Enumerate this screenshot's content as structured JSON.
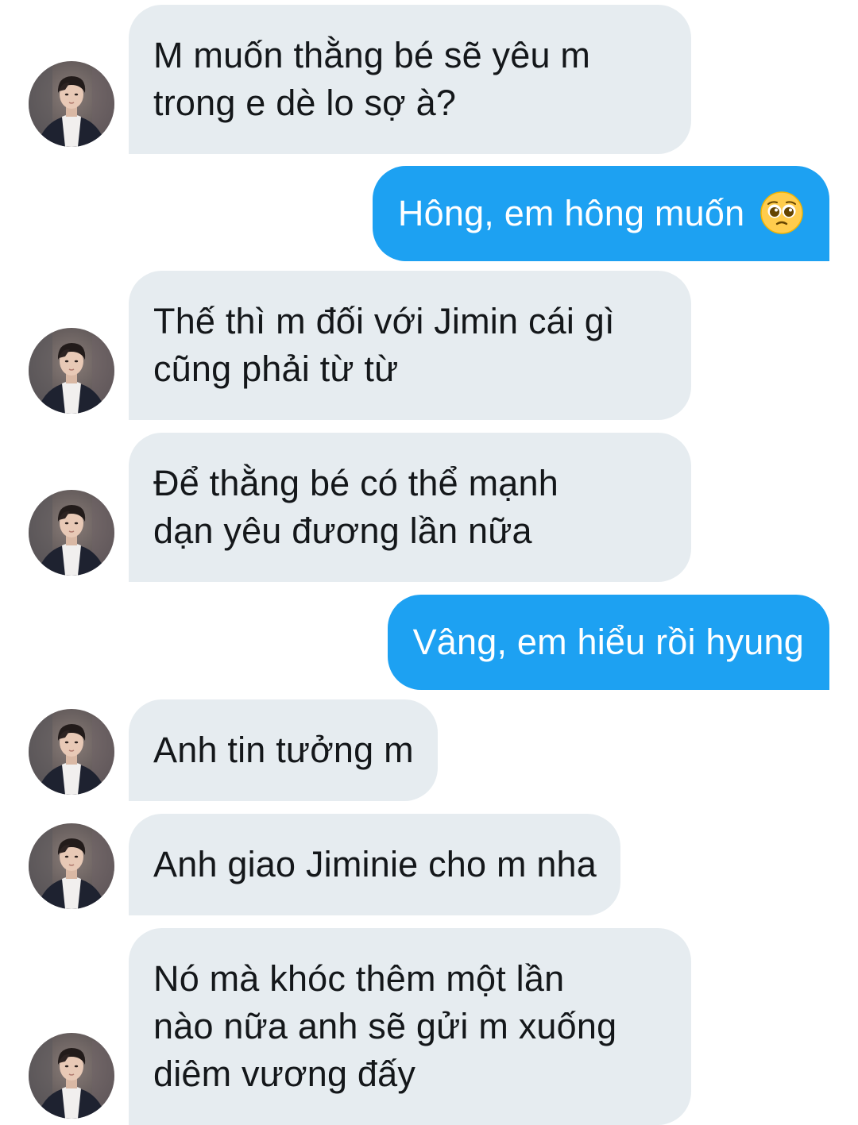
{
  "conversation": {
    "messages": [
      {
        "id": 1,
        "direction": "received",
        "lines": [
          "M muốn thằng bé sẽ yêu m",
          "trong e dè lo sợ à?"
        ]
      },
      {
        "id": 2,
        "direction": "sent",
        "text": "Hông, em hông muốn",
        "emoji": "pleading-face-emoji"
      },
      {
        "id": 3,
        "direction": "received",
        "lines": [
          "Thế thì m đối với Jimin cái gì",
          "cũng phải từ từ"
        ]
      },
      {
        "id": 4,
        "direction": "received",
        "lines": [
          "Để thằng bé có thể mạnh",
          "dạn yêu đương lần nữa"
        ]
      },
      {
        "id": 5,
        "direction": "sent",
        "text": "Vâng, em hiểu rồi hyung"
      },
      {
        "id": 6,
        "direction": "received",
        "lines": [
          "Anh tin tưởng m"
        ]
      },
      {
        "id": 7,
        "direction": "received",
        "lines": [
          "Anh giao Jiminie cho m nha"
        ]
      },
      {
        "id": 8,
        "direction": "received",
        "lines": [
          "Nó mà khóc thêm một lần",
          "nào nữa anh sẽ gửi m xuống",
          "diêm vương đấy"
        ]
      }
    ]
  },
  "colors": {
    "received_bubble": "#e6ecf0",
    "received_text": "#14171a",
    "sent_bubble": "#1da1f2",
    "sent_text": "#ffffff"
  }
}
